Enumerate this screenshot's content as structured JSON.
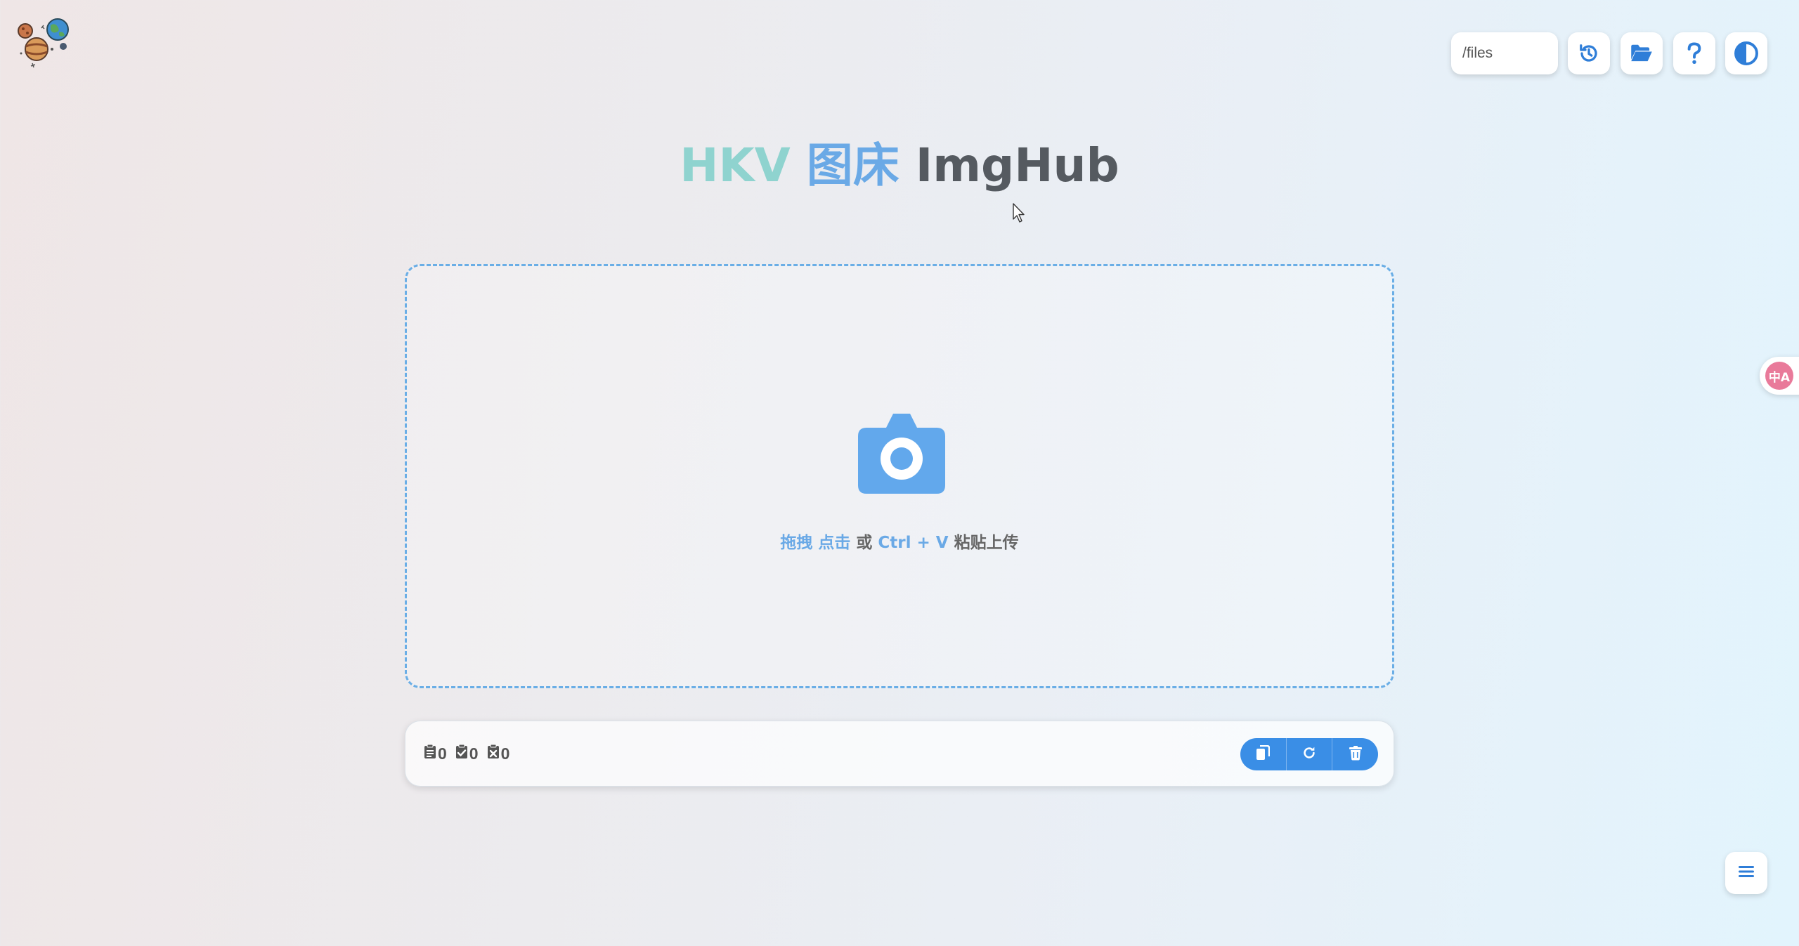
{
  "toolbar": {
    "path_value": "/files",
    "history_icon": "history-icon",
    "folder_icon": "folder-open-icon",
    "help_icon": "question-icon",
    "theme_icon": "half-circle-contrast-icon"
  },
  "title": {
    "part1": "HKV",
    "part2": "图床",
    "part3": "ImgHub"
  },
  "dropzone": {
    "icon": "camera-icon",
    "hint_drag": "拖拽",
    "hint_click": "点击",
    "hint_or": "或",
    "hint_shortcut": "Ctrl + V",
    "hint_paste": "粘贴上传"
  },
  "stats": {
    "total": "0",
    "success": "0",
    "failed": "0"
  },
  "actions": {
    "copy_icon": "copy-icon",
    "retry_icon": "redo-icon",
    "clear_icon": "trash-icon"
  },
  "translate": {
    "label": "中A"
  },
  "colors": {
    "accent": "#3a8ee6",
    "title_teal": "#8fd3cf",
    "title_blue": "#6aa9e6",
    "title_dark": "#555a60",
    "dash_border": "#6aaee6"
  }
}
